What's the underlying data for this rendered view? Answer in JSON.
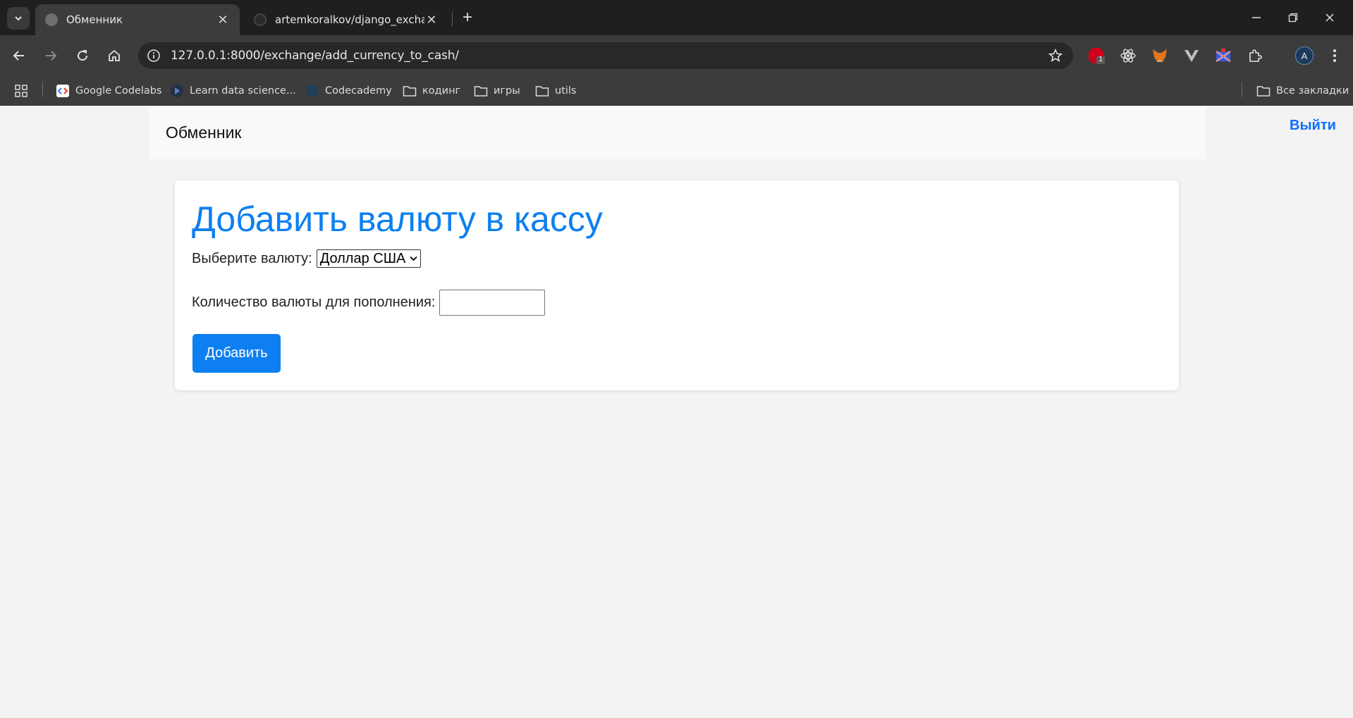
{
  "browser": {
    "tabs": [
      {
        "title": "Обменник",
        "active": true
      },
      {
        "title": "artemkoralkov/django_exchang",
        "active": false
      }
    ],
    "url": "127.0.0.1:8000/exchange/add_currency_to_cash/",
    "extension_badge": "1",
    "profile_initial": "A",
    "bookmarks": [
      {
        "label": "Google Codelabs"
      },
      {
        "label": "Learn data science..."
      },
      {
        "label": "Codecademy"
      },
      {
        "label": "кодинг"
      },
      {
        "label": "игры"
      },
      {
        "label": "utils"
      }
    ],
    "all_bookmarks": "Все закладки"
  },
  "page": {
    "brand": "Обменник",
    "logout": "Выйти",
    "heading": "Добавить валюту в кассу",
    "currency_label": "Выберите валюту:",
    "currency_selected": "Доллар США",
    "amount_label": "Количество валюты для пополнения:",
    "amount_value": "",
    "submit_label": "Добавить",
    "colors": {
      "accent": "#0d7ff0",
      "navbar_bg": "#f8f9fa",
      "page_bg": "#f3f3f3"
    }
  }
}
